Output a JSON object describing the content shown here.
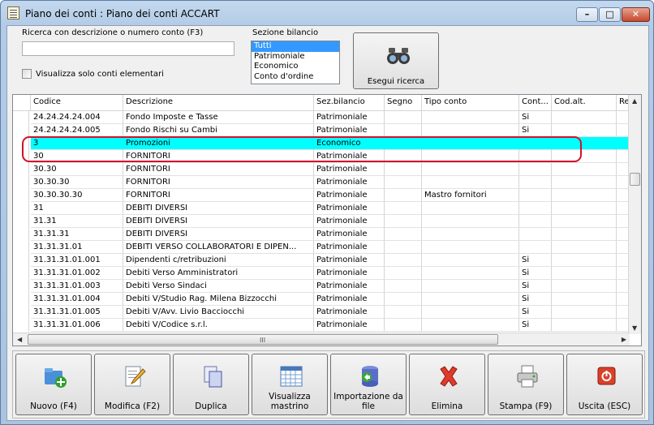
{
  "window": {
    "title": "Piano dei conti : Piano dei conti ACCART",
    "min_label": "–",
    "max_label": "□",
    "close_label": "✕"
  },
  "search": {
    "label": "Ricerca con descrizione o numero conto (F3)",
    "value": "",
    "only_elementary_label": "Visualizza solo conti elementari",
    "only_elementary_checked": false
  },
  "section": {
    "label": "Sezione bilancio",
    "options": [
      "Tutti",
      "Patrimoniale",
      "Economico",
      "Conto d'ordine"
    ],
    "selected": "Tutti"
  },
  "search_button": {
    "label": "Esegui ricerca",
    "icon": "binoculars-icon"
  },
  "grid": {
    "columns": [
      "Codice",
      "Descrizione",
      "Sez.bilancio",
      "Segno",
      "Tipo conto",
      "Cont...",
      "Cod.alt.",
      "Re"
    ],
    "rows": [
      [
        "24.24.24.24.004",
        "Fondo Imposte e Tasse",
        "Patrimoniale",
        "",
        "",
        "Si",
        "",
        ""
      ],
      [
        "24.24.24.24.005",
        "Fondo Rischi su Cambi",
        "Patrimoniale",
        "",
        "",
        "Si",
        "",
        ""
      ],
      [
        "3",
        "Promozioni",
        "Economico",
        "",
        "",
        "",
        "",
        ""
      ],
      [
        "30",
        "FORNITORI",
        "Patrimoniale",
        "",
        "",
        "",
        "",
        ""
      ],
      [
        "30.30",
        "FORNITORI",
        "Patrimoniale",
        "",
        "",
        "",
        "",
        ""
      ],
      [
        "30.30.30",
        "FORNITORI",
        "Patrimoniale",
        "",
        "",
        "",
        "",
        ""
      ],
      [
        "30.30.30.30",
        "FORNITORI",
        "Patrimoniale",
        "",
        "Mastro fornitori",
        "",
        "",
        ""
      ],
      [
        "31",
        "DEBITI DIVERSI",
        "Patrimoniale",
        "",
        "",
        "",
        "",
        ""
      ],
      [
        "31.31",
        "DEBITI DIVERSI",
        "Patrimoniale",
        "",
        "",
        "",
        "",
        ""
      ],
      [
        "31.31.31",
        "DEBITI DIVERSI",
        "Patrimoniale",
        "",
        "",
        "",
        "",
        ""
      ],
      [
        "31.31.31.01",
        "DEBITI VERSO COLLABORATORI E DIPEN...",
        "Patrimoniale",
        "",
        "",
        "",
        "",
        ""
      ],
      [
        "31.31.31.01.001",
        "Dipendenti c/retribuzioni",
        "Patrimoniale",
        "",
        "",
        "Si",
        "",
        ""
      ],
      [
        "31.31.31.01.002",
        "Debiti Verso Amministratori",
        "Patrimoniale",
        "",
        "",
        "Si",
        "",
        ""
      ],
      [
        "31.31.31.01.003",
        "Debiti Verso Sindaci",
        "Patrimoniale",
        "",
        "",
        "Si",
        "",
        ""
      ],
      [
        "31.31.31.01.004",
        "Debiti V/Studio Rag. Milena Bizzocchi",
        "Patrimoniale",
        "",
        "",
        "Si",
        "",
        ""
      ],
      [
        "31.31.31.01.005",
        "Debiti V/Avv. Livio Bacciocchi",
        "Patrimoniale",
        "",
        "",
        "Si",
        "",
        ""
      ],
      [
        "31.31.31.01.006",
        "Debiti V/Codice s.r.l.",
        "Patrimoniale",
        "",
        "",
        "Si",
        "",
        ""
      ]
    ],
    "selected_row": 2,
    "selected_color": "#00ffff",
    "highlight_color": "#d1112b",
    "hscroll_grip": "III"
  },
  "toolbar": {
    "buttons": [
      {
        "label": "Nuovo (F4)",
        "icon": "new-folder-icon"
      },
      {
        "label": "Modifica (F2)",
        "icon": "edit-pencil-icon"
      },
      {
        "label": "Duplica",
        "icon": "duplicate-icon"
      },
      {
        "label": "Visualizza mastrino",
        "icon": "calendar-grid-icon"
      },
      {
        "label": "Importazione da file",
        "icon": "database-import-icon"
      },
      {
        "label": "Elimina",
        "icon": "delete-x-icon"
      },
      {
        "label": "Stampa (F9)",
        "icon": "printer-icon"
      },
      {
        "label": "Uscita (ESC)",
        "icon": "power-exit-icon"
      }
    ]
  }
}
